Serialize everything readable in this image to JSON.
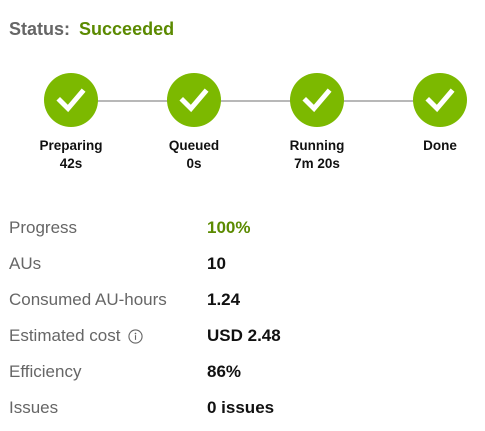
{
  "status": {
    "label": "Status:",
    "value": "Succeeded",
    "value_color": "#5b8a00"
  },
  "accent_color": "#7cb900",
  "steps": [
    {
      "label": "Preparing",
      "time": "42s",
      "icon": "check-icon",
      "state": "complete"
    },
    {
      "label": "Queued",
      "time": "0s",
      "icon": "check-icon",
      "state": "complete"
    },
    {
      "label": "Running",
      "time": "7m 20s",
      "icon": "check-icon",
      "state": "complete"
    },
    {
      "label": "Done",
      "time": "",
      "icon": "check-icon",
      "state": "complete"
    }
  ],
  "properties": {
    "progress": {
      "label": "Progress",
      "value": "100%"
    },
    "aus": {
      "label": "AUs",
      "value": "10"
    },
    "consumed": {
      "label": "Consumed AU-hours",
      "value": "1.24"
    },
    "cost": {
      "label": "Estimated cost",
      "value": "USD 2.48",
      "icon": "info-icon"
    },
    "efficiency": {
      "label": "Efficiency",
      "value": "86%"
    },
    "issues": {
      "label": "Issues",
      "value": "0 issues"
    }
  }
}
